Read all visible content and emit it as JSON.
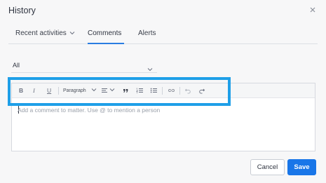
{
  "dialog": {
    "title": "History",
    "close_icon": "close-icon"
  },
  "tabs": [
    {
      "label": "Recent activities",
      "icon": "chevron-down-icon"
    },
    {
      "label": "Comments",
      "active": true
    },
    {
      "label": "Alerts"
    }
  ],
  "filter": {
    "value": "All",
    "icon": "chevron-down-icon"
  },
  "toolbar": {
    "bold": "B",
    "italic": "I",
    "underline": "U",
    "paragraph": "Paragraph",
    "icons": [
      "bold-icon",
      "italic-icon",
      "underline-icon",
      "chevron-down-icon",
      "align-icon",
      "chevron-down-icon",
      "blockquote-icon",
      "numbered-list-icon",
      "bulleted-list-icon",
      "link-icon",
      "undo-icon",
      "redo-icon"
    ]
  },
  "editor": {
    "placeholder": "Add a comment to matter. Use @ to mention a person"
  },
  "buttons": {
    "cancel": "Cancel",
    "save": "Save"
  },
  "colors": {
    "accent": "#1976e8",
    "highlight": "#1e9fe8",
    "tab_underline": "#2a7de1"
  }
}
